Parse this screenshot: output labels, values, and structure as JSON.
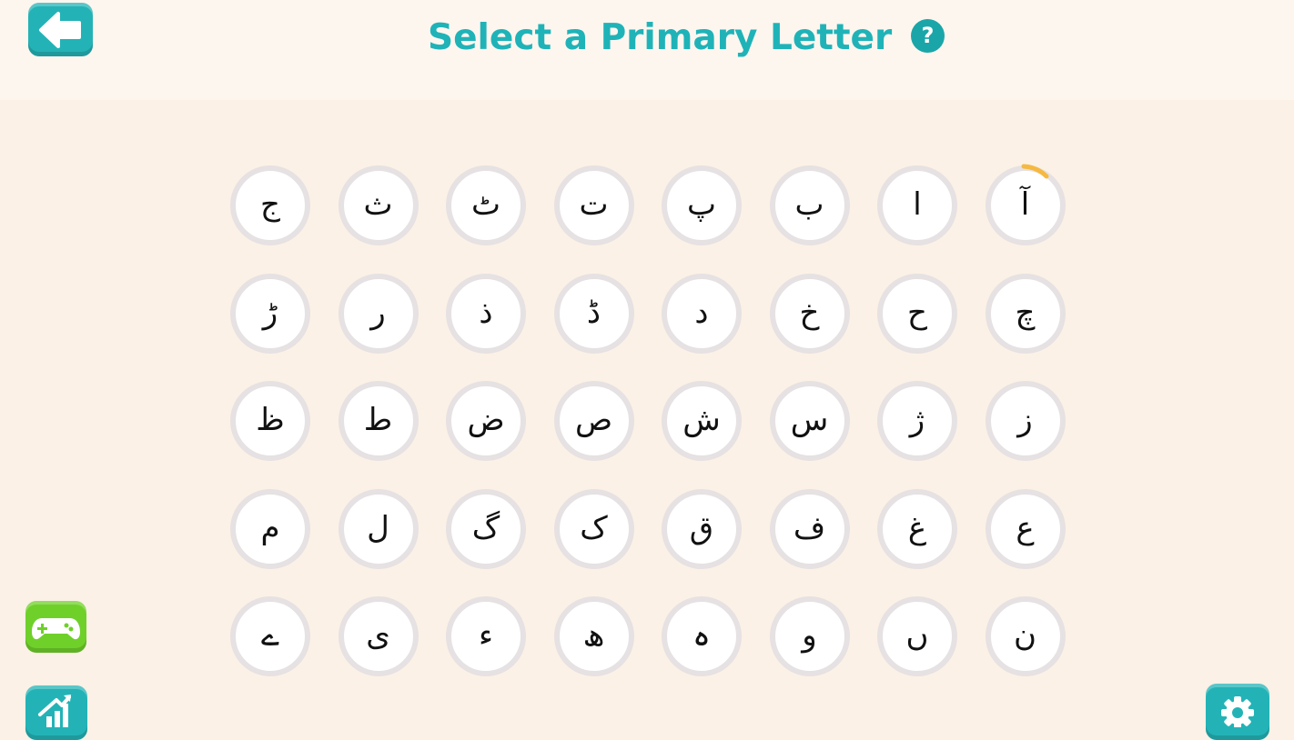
{
  "header": {
    "title": "Select a Primary Letter",
    "help_label": "?"
  },
  "letters": [
    [
      "ج",
      "ث",
      "ٹ",
      "ت",
      "پ",
      "ب",
      "ا",
      "آ"
    ],
    [
      "ڑ",
      "ر",
      "ذ",
      "ڈ",
      "د",
      "خ",
      "ح",
      "چ"
    ],
    [
      "ظ",
      "ط",
      "ض",
      "ص",
      "ش",
      "س",
      "ژ",
      "ز"
    ],
    [
      "م",
      "ل",
      "گ",
      "ک",
      "ق",
      "ف",
      "غ",
      "ع"
    ],
    [
      "ے",
      "ی",
      "ء",
      "ھ",
      "ہ",
      "و",
      "ں",
      "ن"
    ]
  ],
  "icons": {
    "back": "arrow-left-icon",
    "games": "gamepad-icon",
    "stats": "chart-up-icon",
    "settings": "gear-icon",
    "help": "question-icon"
  },
  "colors": {
    "teal": "#23b3b6",
    "green": "#6fd02a",
    "highlight": "#f5b942",
    "background": "#fbf1e6"
  }
}
